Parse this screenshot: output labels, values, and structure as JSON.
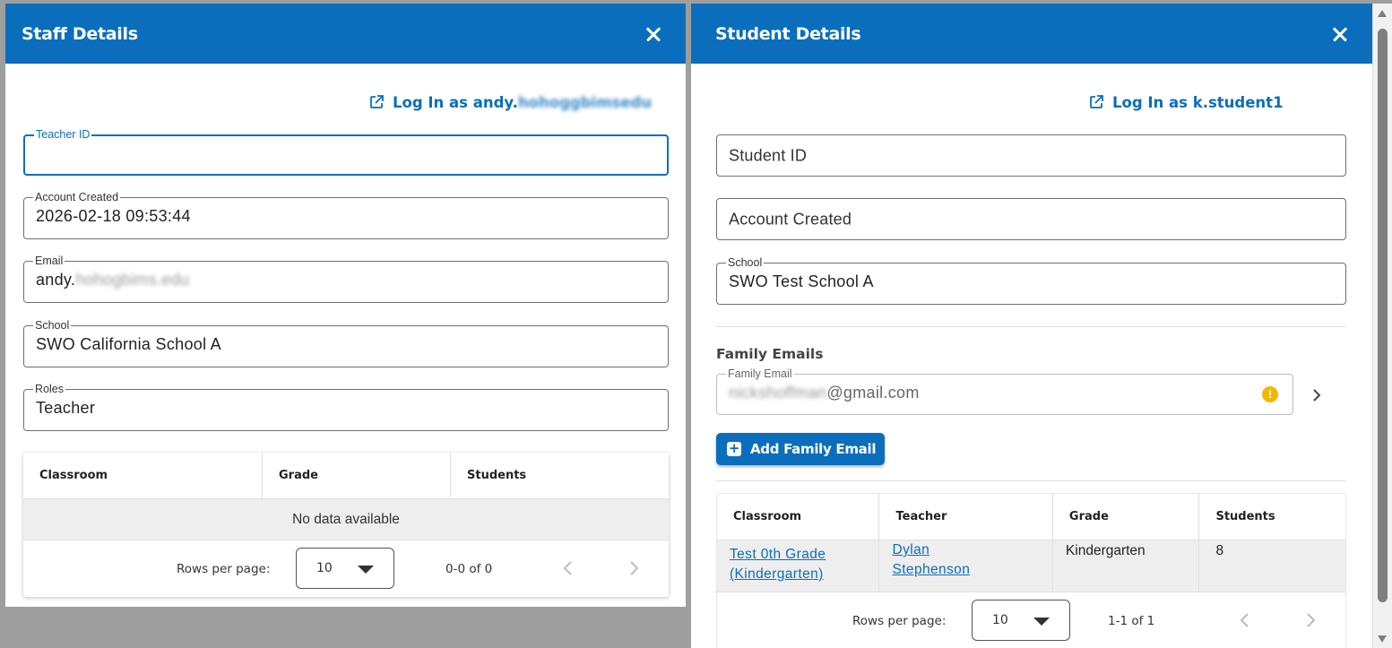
{
  "staff": {
    "title": "Staff Details",
    "login": {
      "prefix": "Log In as andy.",
      "obscured": "hohoggbimsedu"
    },
    "fields": {
      "teacher_id": {
        "label": "Teacher ID",
        "value": ""
      },
      "account_created": {
        "label": "Account Created",
        "value": "2026-02-18 09:53:44"
      },
      "email": {
        "label": "Email",
        "prefix": "andy.",
        "obscured": "hohogbims.edu"
      },
      "school": {
        "label": "School",
        "value": "SWO California School A"
      },
      "roles": {
        "label": "Roles",
        "value": "Teacher"
      }
    },
    "table": {
      "columns": [
        "Classroom",
        "Grade",
        "Students"
      ],
      "empty_text": "No data available",
      "rows_per_page_label": "Rows per page:",
      "rows_per_page": "10",
      "range": "0-0 of 0"
    }
  },
  "student": {
    "title": "Student Details",
    "login": {
      "label": "Log In as k.student1"
    },
    "fields": {
      "student_id": {
        "placeholder": "Student ID"
      },
      "account_created": {
        "placeholder": "Account Created"
      },
      "school": {
        "label": "School",
        "value": "SWO Test School A"
      }
    },
    "family": {
      "section_title": "Family Emails",
      "email_label": "Family Email",
      "email_obscured": "nickshoffman",
      "email_suffix": "@gmail.com",
      "warning_glyph": "!",
      "add_button": "Add Family Email"
    },
    "table": {
      "columns": [
        "Classroom",
        "Teacher",
        "Grade",
        "Students"
      ],
      "rows": [
        {
          "classroom": [
            "Test 0th Grade",
            "(Kindergarten)"
          ],
          "teacher": [
            "Dylan",
            "Stephenson"
          ],
          "grade": "Kindergarten",
          "students": "8"
        }
      ],
      "rows_per_page_label": "Rows per page:",
      "rows_per_page": "10",
      "range": "1-1 of 1"
    }
  },
  "icons": {
    "close": "close-icon",
    "external": "external-link-icon",
    "warning": "warning-icon",
    "chevron": "chevron-right-icon",
    "plus": "plus-icon",
    "caret": "caret-down-icon"
  },
  "colors": {
    "accent": "#0a6ebd",
    "warning": "#f2b705",
    "row_bg": "#eeeeee"
  }
}
